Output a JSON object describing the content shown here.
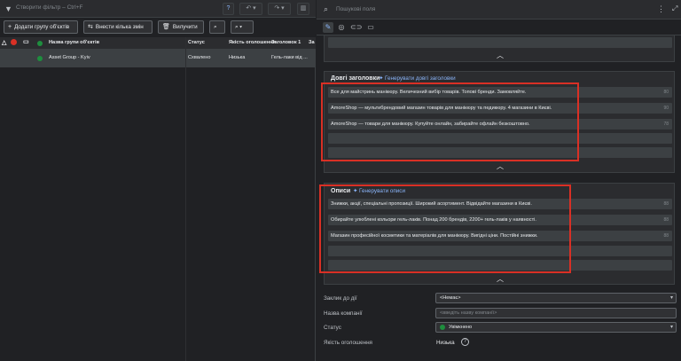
{
  "left": {
    "filter_placeholder": "Створити фільтр – Ctrl+F",
    "actions": {
      "add_group": "Додати групу об'єктів",
      "bulk_edit": "Внести кілька змін",
      "delete": "Вилучити"
    },
    "table": {
      "columns": [
        "Назва групи об'єктів",
        "Статус",
        "Якість оголошення",
        "Заголовок 1",
        "За"
      ],
      "rows": [
        {
          "name": "Asset Group - Kyiv",
          "status": "Схвалено",
          "quality": "Низька",
          "headline": "Гель-лаки від ..."
        }
      ]
    }
  },
  "right": {
    "search_placeholder": "Пошукові поля",
    "long_headlines": {
      "title": "Довгі заголовки",
      "generate": "Генерувати довгі заголовки",
      "items": [
        {
          "text": "Все для майстринь манікюру. Величезний вибір товарів. Топові бренди. Замовляйте.",
          "count": "80"
        },
        {
          "text": "AmoreShop — мультибрендовий магазин товарів для манікюру та педикюру. 4 магазини в Києві.",
          "count": "90"
        },
        {
          "text": "AmoreShop — товари для манікюру. Купуйте онлайн, забирайте офлайн безкоштовно.",
          "count": "78"
        },
        {
          "text": "",
          "count": ""
        },
        {
          "text": "",
          "count": ""
        }
      ]
    },
    "descriptions": {
      "title": "Описи",
      "generate": "Генерувати описи",
      "items": [
        {
          "text": "Знижки, акції, спеціальні пропозиції. Широкий асортимент. Відвідайте магазини в Києві.",
          "count": "88"
        },
        {
          "text": "Обирайте улюблені кольори гель-лаків. Понад 200 брендів, 2200+ гель-лаків у наявності.",
          "count": "88"
        },
        {
          "text": "Магазин професійної косметики та матеріалів для манікюру. Вигідні ціни. Постійні знижки.",
          "count": "88"
        },
        {
          "text": "",
          "count": ""
        },
        {
          "text": "",
          "count": ""
        }
      ]
    },
    "fields": {
      "cta_label": "Заклик до дії",
      "cta_value": "<Немає>",
      "company_label": "Назва компанії",
      "company_placeholder": "<введіть назву компанії>",
      "status_label": "Статус",
      "status_value": "Увімкнено",
      "quality_label": "Якість оголошення",
      "quality_value": "Низька"
    }
  },
  "colors": {
    "accent": "#8ab4f8",
    "highlight": "#d93025",
    "status_green": "#1e8e3e"
  }
}
